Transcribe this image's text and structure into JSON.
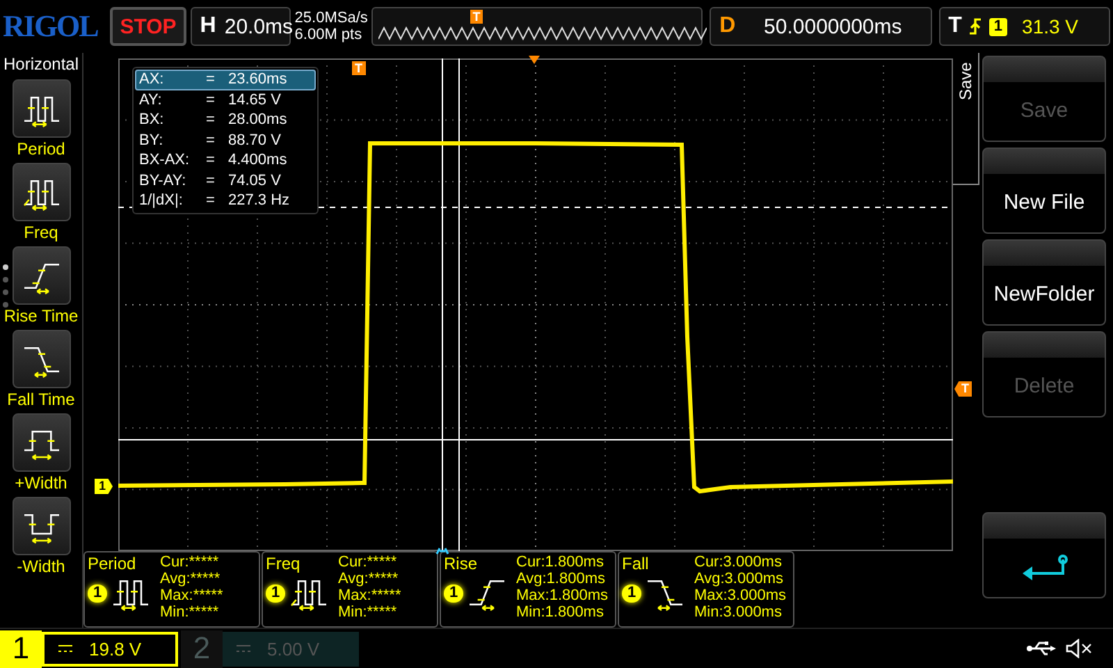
{
  "top_bar": {
    "logo": "RIGOL",
    "run_state": "STOP",
    "timebase": {
      "label": "H",
      "value": "20.0ms"
    },
    "sample_rate": "25.0MSa/s",
    "memory_depth": "6.00M pts",
    "memory_marker": "T",
    "delay": {
      "label": "D",
      "value": "50.0000000ms"
    },
    "trigger": {
      "label": "T",
      "channel": "1",
      "level": "31.3 V"
    }
  },
  "left_menu": {
    "title": "Horizontal",
    "pages": [
      {
        "selected": true
      },
      {
        "selected": false
      },
      {
        "selected": false
      },
      {
        "selected": false
      }
    ],
    "items": [
      {
        "label": "Period",
        "kind": "period"
      },
      {
        "label": "Freq",
        "kind": "freq"
      },
      {
        "label": "Rise Time",
        "kind": "rise"
      },
      {
        "label": "Fall Time",
        "kind": "fall"
      },
      {
        "label": "+Width",
        "kind": "pwidth"
      },
      {
        "label": "-Width",
        "kind": "nwidth"
      }
    ]
  },
  "plot": {
    "trigger_position_marker": "T",
    "trigger_level_marker": "T",
    "channel_marker": "1",
    "cursor_readout": [
      {
        "label": "AX:",
        "eq": "=",
        "value": "23.60ms",
        "selected": true
      },
      {
        "label": "AY:",
        "eq": "=",
        "value": "14.65 V",
        "selected": false
      },
      {
        "label": "BX:",
        "eq": "=",
        "value": "28.00ms",
        "selected": false
      },
      {
        "label": "BY:",
        "eq": "=",
        "value": "88.70 V",
        "selected": false
      },
      {
        "label": "BX-AX:",
        "eq": "=",
        "value": "4.400ms",
        "selected": false
      },
      {
        "label": "BY-AY:",
        "eq": "=",
        "value": "74.05 V",
        "selected": false
      },
      {
        "label": "1/|dX|:",
        "eq": "=",
        "value": "227.3 Hz",
        "selected": false
      }
    ]
  },
  "measurements": [
    {
      "name": "Period",
      "source": "1",
      "kind": "period",
      "stats": [
        {
          "label": "Cur:",
          "value": "*****"
        },
        {
          "label": "Avg:",
          "value": "*****"
        },
        {
          "label": "Max:",
          "value": "*****"
        },
        {
          "label": "Min:",
          "value": "*****"
        }
      ]
    },
    {
      "name": "Freq",
      "source": "1",
      "kind": "freq",
      "stats": [
        {
          "label": "Cur:",
          "value": "*****"
        },
        {
          "label": "Avg:",
          "value": "*****"
        },
        {
          "label": "Max:",
          "value": "*****"
        },
        {
          "label": "Min:",
          "value": "*****"
        }
      ]
    },
    {
      "name": "Rise",
      "source": "1",
      "kind": "rise",
      "stats": [
        {
          "label": "Cur:",
          "value": "1.800ms"
        },
        {
          "label": "Avg:",
          "value": "1.800ms"
        },
        {
          "label": "Max:",
          "value": "1.800ms"
        },
        {
          "label": "Min:",
          "value": "1.800ms"
        }
      ]
    },
    {
      "name": "Fall",
      "source": "1",
      "kind": "fall",
      "stats": [
        {
          "label": "Cur:",
          "value": "3.000ms"
        },
        {
          "label": "Avg:",
          "value": "3.000ms"
        },
        {
          "label": "Max:",
          "value": "3.000ms"
        },
        {
          "label": "Min:",
          "value": "3.000ms"
        }
      ]
    }
  ],
  "softkeys": {
    "title": "Save",
    "buttons": [
      {
        "kind": "text",
        "label": "Save",
        "disabled": true
      },
      {
        "kind": "text",
        "label": "New File",
        "disabled": false
      },
      {
        "kind": "text",
        "label": "NewFolder",
        "disabled": false
      },
      {
        "kind": "text",
        "label": "Delete",
        "disabled": true
      },
      {
        "kind": "spacer"
      },
      {
        "kind": "back"
      }
    ]
  },
  "status_bar": {
    "channels": [
      {
        "number": "1",
        "scale": "19.8 V",
        "active": true
      },
      {
        "number": "2",
        "scale": "5.00 V",
        "active": false
      }
    ]
  }
}
